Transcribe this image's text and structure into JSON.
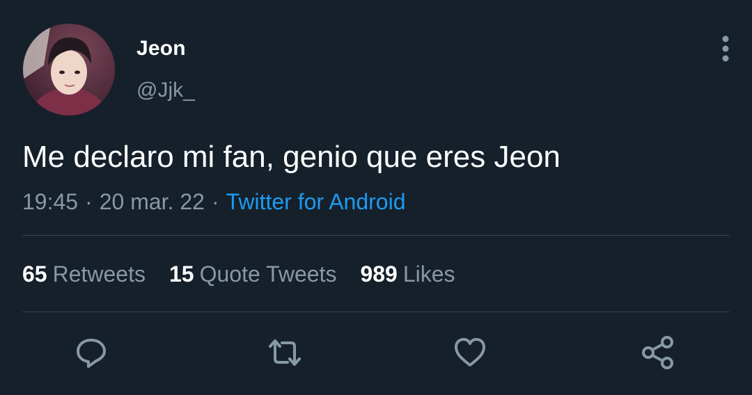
{
  "author": {
    "name": "Jeon",
    "handle": "@Jjk_",
    "avatar_icon": "profile-photo"
  },
  "tweet": {
    "text": "Me declaro mi fan, genio que eres Jeon",
    "time": "19:45",
    "separator": "·",
    "date": "20 mar. 22",
    "source": "Twitter for Android"
  },
  "stats": {
    "retweets_count": "65",
    "retweets_label": "Retweets",
    "quotes_count": "15",
    "quotes_label": "Quote Tweets",
    "likes_count": "989",
    "likes_label": "Likes"
  },
  "actions": {
    "icons": [
      "reply-icon",
      "retweet-icon",
      "like-icon",
      "share-icon"
    ]
  },
  "colors": {
    "background": "#15202b",
    "text": "#ffffff",
    "secondary_text": "#8899a6",
    "link": "#1d9bf0",
    "divider": "#38444d"
  }
}
